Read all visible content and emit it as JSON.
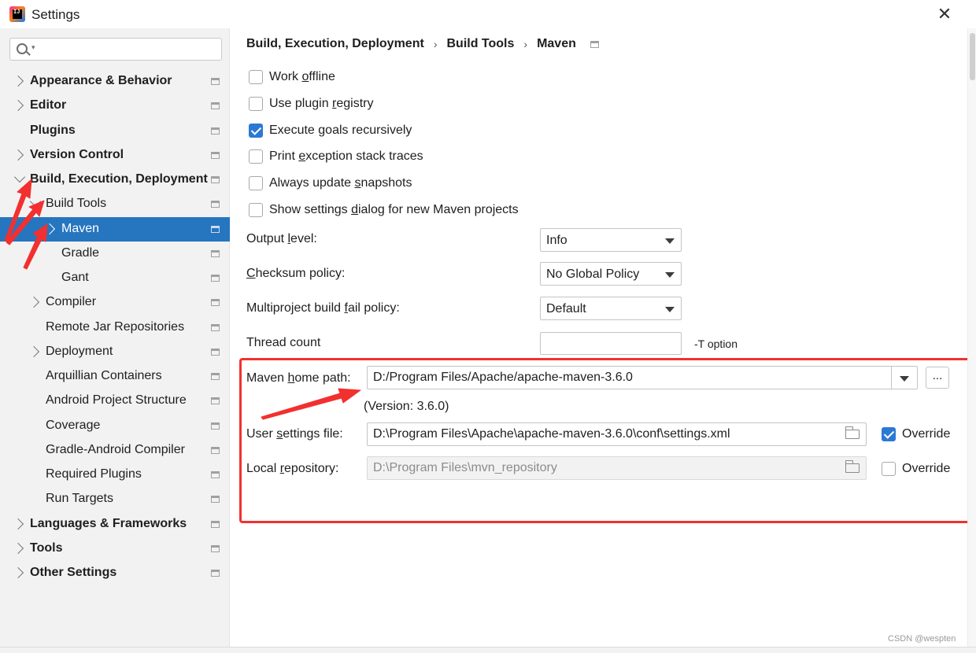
{
  "window": {
    "title": "Settings",
    "close_symbol": "✕"
  },
  "search": {
    "placeholder": ""
  },
  "sidebar": {
    "items": [
      {
        "label": "Appearance & Behavior"
      },
      {
        "label": "Editor"
      },
      {
        "label": "Plugins"
      },
      {
        "label": "Version Control"
      },
      {
        "label": "Build, Execution, Deployment"
      },
      {
        "label": "Build Tools"
      },
      {
        "label": "Maven"
      },
      {
        "label": "Gradle"
      },
      {
        "label": "Gant"
      },
      {
        "label": "Compiler"
      },
      {
        "label": "Remote Jar Repositories"
      },
      {
        "label": "Deployment"
      },
      {
        "label": "Arquillian Containers"
      },
      {
        "label": "Android Project Structure"
      },
      {
        "label": "Coverage"
      },
      {
        "label": "Gradle-Android Compiler"
      },
      {
        "label": "Required Plugins"
      },
      {
        "label": "Run Targets"
      },
      {
        "label": "Languages & Frameworks"
      },
      {
        "label": "Tools"
      },
      {
        "label": "Other Settings"
      }
    ]
  },
  "breadcrumb": {
    "items": [
      "Build, Execution, Deployment",
      "Build Tools",
      "Maven"
    ],
    "separator": "›"
  },
  "options": {
    "work_offline": {
      "pre": "Work ",
      "mn": "o",
      "post": "ffline",
      "checked": false
    },
    "plugin_registry": {
      "pre": "Use plugin ",
      "mn": "r",
      "post": "egistry",
      "checked": false
    },
    "execute_goals": {
      "pre": "Execute ",
      "mn": "g",
      "post": "oals recursively",
      "checked": true
    },
    "print_exception": {
      "pre": "Print ",
      "mn": "e",
      "post": "xception stack traces",
      "checked": false
    },
    "always_update": {
      "pre": "Always update ",
      "mn": "s",
      "post": "napshots",
      "checked": false
    },
    "show_dialog": {
      "pre": "Show settings ",
      "mn": "d",
      "post": "ialog for new Maven projects",
      "checked": false
    }
  },
  "fields": {
    "output_level": {
      "pre": "Output ",
      "mn": "l",
      "post": "evel:",
      "value": "Info"
    },
    "checksum_policy": {
      "pre": "",
      "mn": "C",
      "post": "hecksum policy:",
      "value": "No Global Policy"
    },
    "fail_policy": {
      "pre": "Multiproject build ",
      "mn": "f",
      "post": "ail policy:",
      "value": "Default"
    },
    "thread_count": {
      "label": "Thread count",
      "value": "",
      "suffix": "-T option"
    },
    "maven_home": {
      "pre": "Maven ",
      "mn": "h",
      "post": "ome path:",
      "value": "D:/Program Files/Apache/apache-maven-3.6.0",
      "browse_label": "...",
      "version": "(Version: 3.6.0)"
    },
    "user_settings": {
      "pre": "User ",
      "mn": "s",
      "post": "ettings file:",
      "value": "D:\\Program Files\\Apache\\apache-maven-3.6.0\\conf\\settings.xml",
      "override_label": "Override",
      "override": true
    },
    "local_repo": {
      "pre": "Local ",
      "mn": "r",
      "post": "epository:",
      "value": "D:\\Program Files\\mvn_repository",
      "override_label": "Override",
      "override": false
    }
  },
  "watermark": "CSDN @wespten",
  "colors": {
    "selection": "#2675bf",
    "checkbox_checked": "#2c79d3",
    "annotation_red": "#f2302f"
  }
}
